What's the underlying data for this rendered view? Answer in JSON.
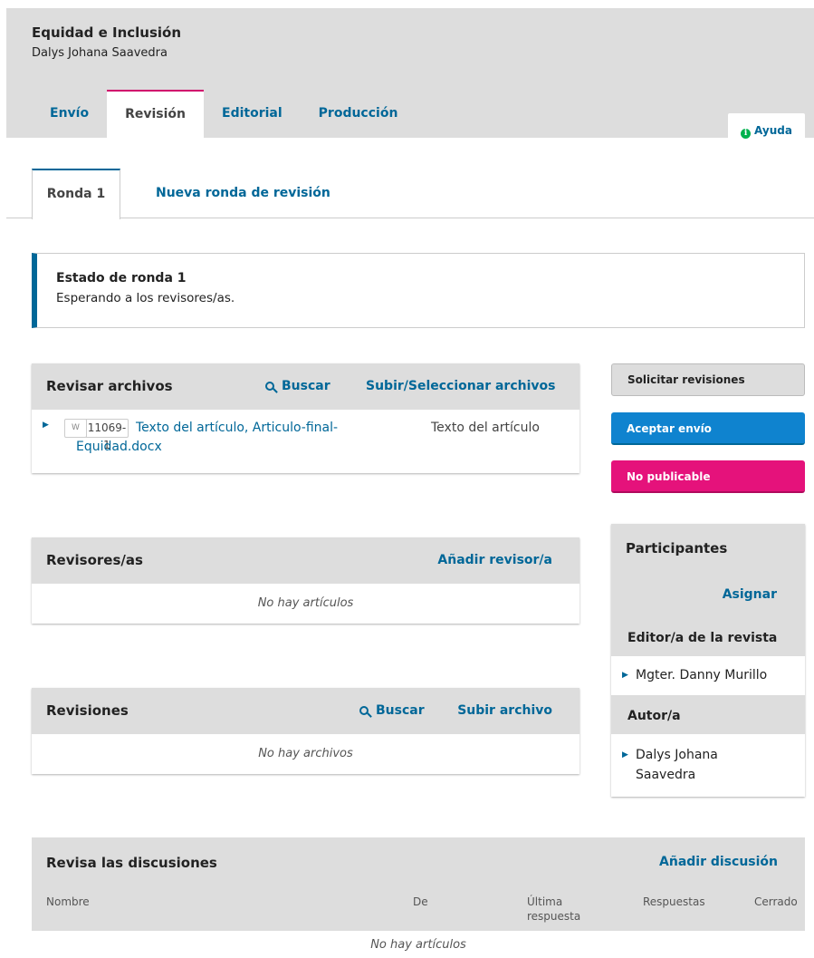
{
  "header": {
    "title": "Equidad e Inclusión",
    "subtitle": "Dalys Johana Saavedra",
    "tabs": [
      "Envío",
      "Revisión",
      "Editorial",
      "Producción"
    ],
    "help_label": "Ayuda"
  },
  "subtabs": {
    "active": "Ronda 1",
    "new_round": "Nueva ronda de revisión"
  },
  "status": {
    "title": "Estado de ronda 1",
    "text": "Esperando a los revisores/as."
  },
  "review_files": {
    "title": "Revisar archivos",
    "search_label": "Buscar",
    "upload_label": "Subir/Seleccionar archivos",
    "file": {
      "id": "11069-1",
      "name_line1": "Texto del artículo, Articulo-final-",
      "name_line2": "Equidad.docx",
      "type": "Texto del artículo"
    }
  },
  "reviewers": {
    "title": "Revisores/as",
    "add_label": "Añadir revisor/a",
    "empty": "No hay artículos"
  },
  "revisions": {
    "title": "Revisiones",
    "search_label": "Buscar",
    "upload_label": "Subir archivo",
    "empty": "No hay archivos"
  },
  "actions": {
    "request_revisions": "Solicitar revisiones",
    "accept": "Aceptar envío",
    "decline": "No publicable"
  },
  "participants": {
    "title": "Participantes",
    "assign_label": "Asignar",
    "groups": [
      {
        "name": "Editor/a de la revista",
        "members": [
          "Mgter. Danny Murillo"
        ]
      },
      {
        "name": "Autor/a",
        "members": [
          "Dalys Johana Saavedra"
        ]
      }
    ],
    "author_line1": "Dalys Johana",
    "author_line2": "Saavedra"
  },
  "discussions": {
    "title": "Revisa las discusiones",
    "add_label": "Añadir discusión",
    "columns": [
      "Nombre",
      "De",
      "Última",
      "respuesta",
      "Respuestas",
      "Cerrado"
    ],
    "empty": "No hay artículos"
  },
  "colors": {
    "accent": "#006798",
    "active_tab": "#d00a6c",
    "accept": "#0f83cf",
    "decline": "#e5127b",
    "help_icon": "#00b24e"
  }
}
